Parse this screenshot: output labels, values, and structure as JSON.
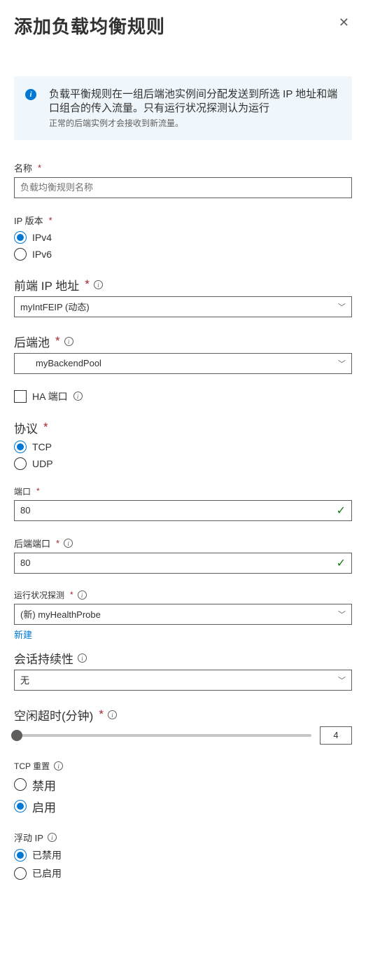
{
  "title": "添加负载均衡规则",
  "info": {
    "main": "负载平衡规则在一组后端池实例间分配发送到所选 IP 地址和端口组合的传入流量。只有运行状况探测认为运行",
    "sub": "正常的后端实例才会接收到新流量。"
  },
  "name": {
    "label": "名称",
    "placeholder": "负载均衡规则名称"
  },
  "ipver": {
    "label": "IP 版本",
    "opt1": "IPv4",
    "opt2": "IPv6"
  },
  "frontend": {
    "label": "前端 IP 地址",
    "value": "myIntFEIP (动态)"
  },
  "backend": {
    "label": "后端池",
    "value": "myBackendPool"
  },
  "haports": {
    "label": "HA 端口"
  },
  "protocol": {
    "label": "协议",
    "opt1": "TCP",
    "opt2": "UDP"
  },
  "port": {
    "label": "端口",
    "value": "80"
  },
  "backendport": {
    "label": "后端端口",
    "value": "80"
  },
  "probe": {
    "label": "运行状况探测",
    "value": "(新) myHealthProbe",
    "createNew": "新建"
  },
  "session": {
    "label": "会话持续性",
    "value": "无"
  },
  "idle": {
    "label": "空闲超时(分钟)",
    "value": "4"
  },
  "tcpreset": {
    "label": "TCP 重置",
    "opt1": "禁用",
    "opt2": "启用"
  },
  "floating": {
    "label": "浮动 IP",
    "opt1": "已禁用",
    "opt2": "已启用"
  }
}
